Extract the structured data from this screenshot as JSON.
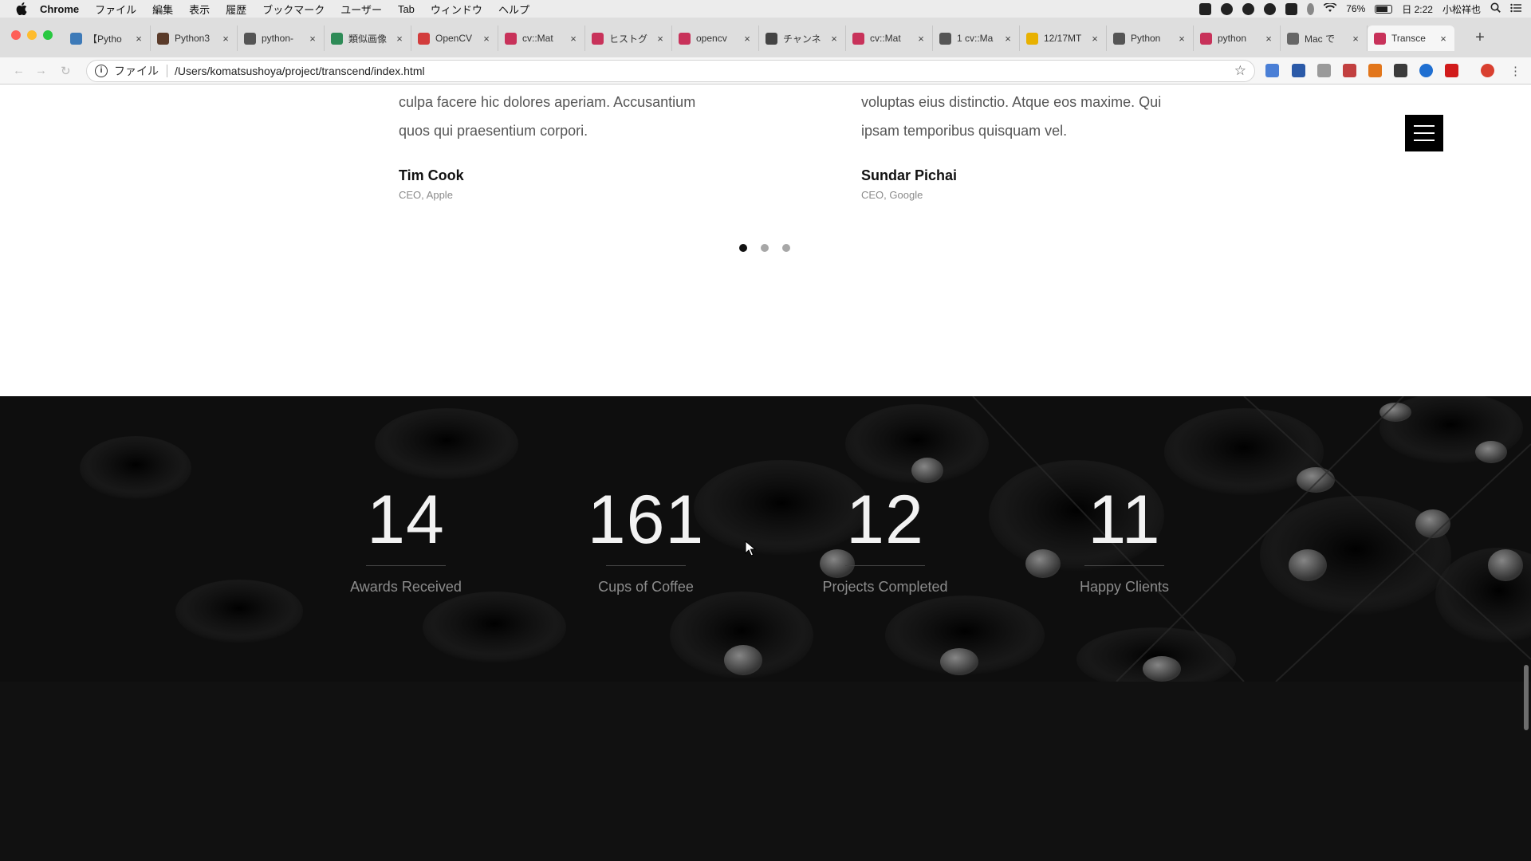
{
  "menubar": {
    "app": "Chrome",
    "items": [
      "ファイル",
      "編集",
      "表示",
      "履歴",
      "ブックマーク",
      "ユーザー",
      "Tab",
      "ウィンドウ",
      "ヘルプ"
    ],
    "battery": "76%",
    "clock": "日 2:22",
    "user": "小松祥也"
  },
  "tabs": [
    {
      "title": "【Pytho",
      "color": "#3d7ab8"
    },
    {
      "title": "Python3",
      "color": "#5a3b2a"
    },
    {
      "title": "python-",
      "color": "#555555"
    },
    {
      "title": "類似画像",
      "color": "#2e8b57"
    },
    {
      "title": "OpenCV",
      "color": "#d23c3c"
    },
    {
      "title": "cv::Mat",
      "color": "#c8325a"
    },
    {
      "title": "ヒストグ",
      "color": "#c8325a"
    },
    {
      "title": "opencv",
      "color": "#c8325a"
    },
    {
      "title": "チャンネ",
      "color": "#444444"
    },
    {
      "title": "cv::Mat",
      "color": "#c8325a"
    },
    {
      "title": "1 cv::Ma",
      "color": "#555555"
    },
    {
      "title": "12/17MT",
      "color": "#e8b100"
    },
    {
      "title": "Python",
      "color": "#555555"
    },
    {
      "title": "python",
      "color": "#c8325a"
    },
    {
      "title": "Mac で",
      "color": "#666666"
    },
    {
      "title": "Transce",
      "color": "#c8325a",
      "active": true
    }
  ],
  "address": {
    "scheme_label": "ファイル",
    "url": "/Users/komatsushoya/project/transcend/index.html"
  },
  "testimonials": {
    "left": {
      "quote_line1": "culpa facere hic dolores aperiam. Accusantium",
      "quote_line2": "quos qui praesentium corpori.",
      "name": "Tim Cook",
      "role": "CEO, Apple"
    },
    "right": {
      "quote_line1": "voluptas eius distinctio. Atque eos maxime. Qui",
      "quote_line2": "ipsam temporibus quisquam vel.",
      "name": "Sundar Pichai",
      "role": "CEO, Google"
    },
    "active_slide": 1,
    "slide_count": 3
  },
  "stats": [
    {
      "number": "14",
      "label": "Awards Received"
    },
    {
      "number": "161",
      "label": "Cups of Coffee"
    },
    {
      "number": "12",
      "label": "Projects Completed"
    },
    {
      "number": "11",
      "label": "Happy Clients"
    }
  ]
}
